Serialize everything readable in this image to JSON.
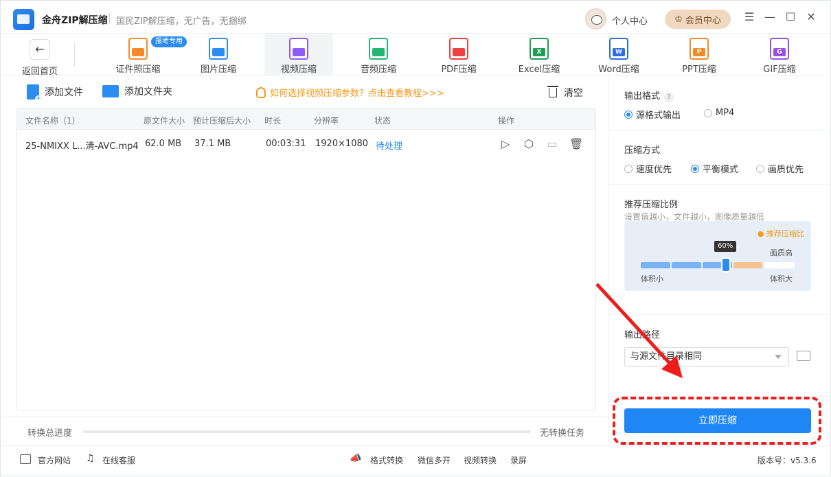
{
  "app": {
    "title": "金舟ZIP解压缩",
    "slogan": "国民ZIP解压缩，无广告，无捆绑",
    "personal": "个人中心",
    "vip": "会员中心"
  },
  "toolbar": {
    "back": "返回首页",
    "badge": "报考专用",
    "tools": [
      {
        "label": "证件照压缩",
        "color": "#f5892d",
        "short": ""
      },
      {
        "label": "图片压缩",
        "color": "#2d8cf0",
        "short": ""
      },
      {
        "label": "视频压缩",
        "color": "#8d5cf6",
        "short": ""
      },
      {
        "label": "音频压缩",
        "color": "#22b573",
        "short": ""
      },
      {
        "label": "PDF压缩",
        "color": "#ee4040",
        "short": ""
      },
      {
        "label": "Excel压缩",
        "color": "#1f9d55",
        "short": "X"
      },
      {
        "label": "Word压缩",
        "color": "#2d6cdf",
        "short": "W"
      },
      {
        "label": "PPT压缩",
        "color": "#f08a24",
        "short": "P"
      },
      {
        "label": "GIF压缩",
        "color": "#9b51e0",
        "short": "G"
      }
    ]
  },
  "actions": {
    "add_file": "添加文件",
    "add_folder": "添加文件夹",
    "tip": "如何选择视频压缩参数？点击查看教程>>>",
    "clear": "清空"
  },
  "table": {
    "headers": [
      "文件名称（1）",
      "原文件大小",
      "预计压缩后大小",
      "时长",
      "分辨率",
      "状态",
      "操作"
    ],
    "rows": [
      {
        "name": "25-NMIXX L...清-AVC.mp4",
        "size": "62.0 MB",
        "est": "37.1 MB",
        "duration": "00:03:31",
        "resolution": "1920×1080",
        "status": "待处理"
      }
    ]
  },
  "progress": {
    "label": "转换总进度",
    "value": 0,
    "right": "无转换任务"
  },
  "settings": {
    "format_title": "输出格式",
    "format_options": [
      "源格式输出",
      "MP4"
    ],
    "mode_title": "压缩方式",
    "mode_options": [
      "速度优先",
      "平衡模式",
      "画质优先"
    ],
    "ratio_title": "推荐压缩比例",
    "ratio_sub": "设置值越小，文件越小，图像质量越低",
    "ratio_recommend": "● 推荐压缩比",
    "ratio_value": "60%",
    "ratio_high": "画质高",
    "ratio_small": "体积小",
    "ratio_large": "体积大",
    "path_title": "输出路径",
    "path_value": "与源文件目录相同",
    "go": "立即压缩"
  },
  "footer": {
    "site": "官方网站",
    "service": "在线客服",
    "links": [
      "格式转换",
      "微信多开",
      "视频转换",
      "录屏"
    ],
    "version": "版本号：v5.3.6"
  }
}
